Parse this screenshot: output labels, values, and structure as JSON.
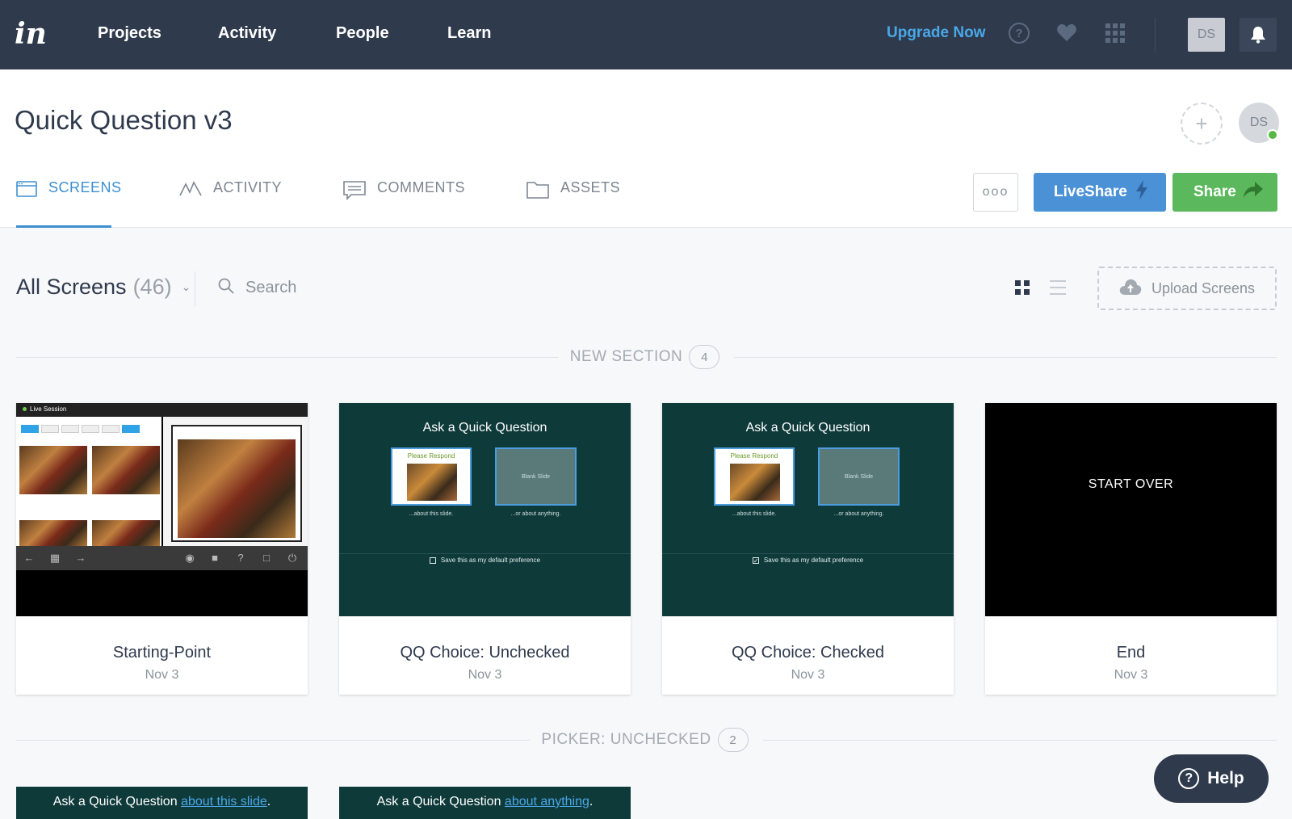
{
  "nav": {
    "logo": "in",
    "items": [
      {
        "label": "Projects"
      },
      {
        "label": "Activity"
      },
      {
        "label": "People"
      },
      {
        "label": "Learn"
      }
    ],
    "upgrade_label": "Upgrade Now",
    "avatar_initials": "DS",
    "icons": [
      "help-icon",
      "heart-icon",
      "apps-grid-icon",
      "bell-icon"
    ]
  },
  "project": {
    "title": "Quick Question v3",
    "add_collaborator": "+",
    "user_initials": "DS"
  },
  "tabs": [
    {
      "label": "SCREENS",
      "active": true,
      "icon": "screens-icon"
    },
    {
      "label": "ACTIVITY",
      "active": false,
      "icon": "activity-icon"
    },
    {
      "label": "COMMENTS",
      "active": false,
      "icon": "comments-icon"
    },
    {
      "label": "ASSETS",
      "active": false,
      "icon": "folder-icon"
    }
  ],
  "actions": {
    "more_label": "ooo",
    "liveshare_label": "LiveShare",
    "share_label": "Share"
  },
  "toolbar": {
    "filter_label": "All Screens",
    "filter_count": "(46)",
    "search_placeholder": "Search",
    "upload_label": "Upload Screens"
  },
  "sections": [
    {
      "label": "NEW SECTION",
      "count": "4",
      "screens": [
        {
          "title": "Starting-Point",
          "date": "Nov 3"
        },
        {
          "title": "QQ Choice: Unchecked",
          "date": "Nov 3"
        },
        {
          "title": "QQ Choice: Checked",
          "date": "Nov 3"
        },
        {
          "title": "End",
          "date": "Nov 3"
        }
      ]
    },
    {
      "label": "PICKER: UNCHECKED",
      "count": "2"
    }
  ],
  "thumbs": {
    "live_session": "Live Session",
    "qq_title": "Ask a Quick Question",
    "please_respond": "Please Respond",
    "blank_slide": "Blank Slide",
    "about_slide": "...about this slide.",
    "about_anything": "...or about anything.",
    "save_pref": "Save this as my default preference",
    "start_over": "START OVER",
    "picker1_prefix": "Ask a Quick Question ",
    "picker1_link": "about this slide",
    "picker2_prefix": "Ask a Quick Question ",
    "picker2_link": "about anything",
    "period": "."
  },
  "help_label": "Help",
  "colors": {
    "nav_bg": "#2f3a4d",
    "accent_blue": "#3d8fd0",
    "share_green": "#5cb85c",
    "thumb_teal": "#0f3a3a"
  }
}
